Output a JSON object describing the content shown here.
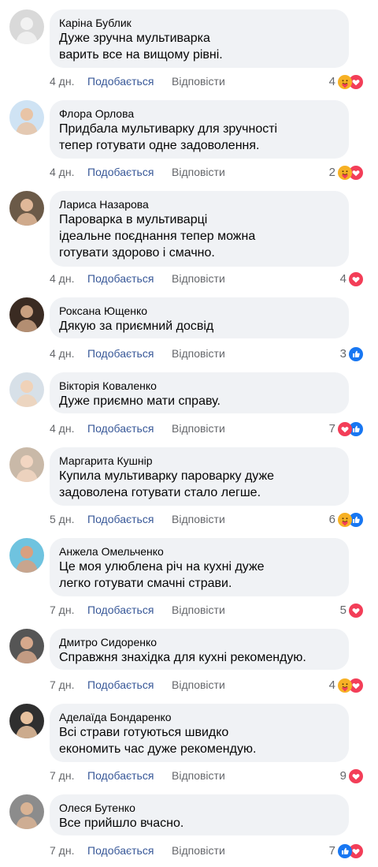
{
  "labels": {
    "like": "Подобається",
    "reply": "Відповісти"
  },
  "colors": {
    "bubble": "#f0f2f5",
    "like_link": "#385898",
    "meta": "#65676b",
    "heart": "#f33e58",
    "like_icon": "#1877f2",
    "care": "#f7b125"
  },
  "comments": [
    {
      "author": "Каріна Бублик",
      "text": "Дуже зручна мультиварка\nварить все на вищому рівні.",
      "time": "4 дн.",
      "count": "4",
      "reactions": [
        "care-icon",
        "heart-icon"
      ]
    },
    {
      "author": "Флора Орлова",
      "text": "Придбала мультиварку для зручності\nтепер готувати одне задоволення.",
      "time": "4 дн.",
      "count": "2",
      "reactions": [
        "care-icon",
        "heart-icon"
      ]
    },
    {
      "author": "Лариса Назарова",
      "text": "Пароварка в мультиварці\nідеальне поєднання тепер можна\nготувати здорово і смачно.",
      "time": "4 дн.",
      "count": "4",
      "reactions": [
        "heart-icon"
      ]
    },
    {
      "author": "Роксана Ющенко",
      "text": "Дякую за приємний досвід",
      "time": "4 дн.",
      "count": "3",
      "reactions": [
        "like-icon"
      ]
    },
    {
      "author": "Вікторія Коваленко",
      "text": "Дуже приємно мати справу.",
      "time": "4 дн.",
      "count": "7",
      "reactions": [
        "heart-icon",
        "like-icon"
      ]
    },
    {
      "author": "Маргарита Кушнір",
      "text": "Купила мультиварку пароварку дуже\nзадоволена готувати стало легше.",
      "time": "5 дн.",
      "count": "6",
      "reactions": [
        "care-icon",
        "like-icon"
      ]
    },
    {
      "author": "Анжела Омельченко",
      "text": "Це моя улюблена річ на кухні дуже\nлегко готувати смачні страви.",
      "time": "7 дн.",
      "count": "5",
      "reactions": [
        "heart-icon"
      ]
    },
    {
      "author": "Дмитро Сидоренко",
      "text": "Справжня знахідка для кухні рекомендую.",
      "time": "7 дн.",
      "count": "4",
      "reactions": [
        "care-icon",
        "heart-icon"
      ]
    },
    {
      "author": "Аделаїда Бондаренко",
      "text": "Всі страви готуються швидко\nекономить час дуже рекомендую.",
      "time": "7 дн.",
      "count": "9",
      "reactions": [
        "heart-icon"
      ]
    },
    {
      "author": "Олеся Бутенко",
      "text": "Все прийшло вчасно.",
      "time": "7 дн.",
      "count": "7",
      "reactions": [
        "like-icon",
        "heart-icon"
      ]
    }
  ]
}
